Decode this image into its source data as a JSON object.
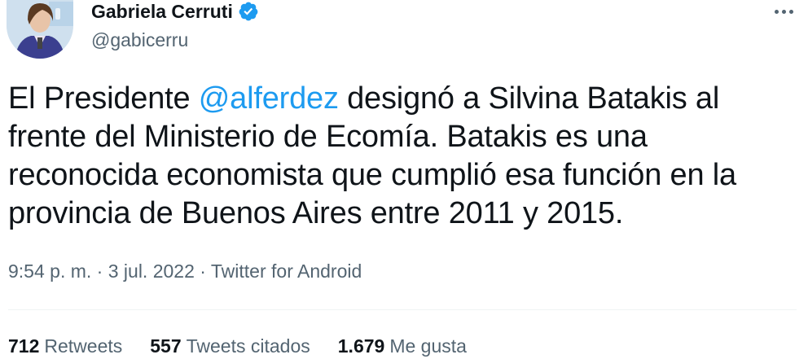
{
  "author": {
    "display_name": "Gabriela Cerruti",
    "handle": "@gabicerru",
    "verified": true,
    "verified_color": "#1d9bf0"
  },
  "tweet": {
    "text_before": "El Presidente ",
    "mention": "@alferdez",
    "text_after": " designó a Silvina Batakis al frente del Ministerio de Ecomía. Batakis es una reconocida economista que cumplió esa función en la provincia de Buenos Aires entre 2011 y 2015.",
    "mention_color": "#1d9bf0"
  },
  "meta": {
    "time": "9:54 p. m.",
    "separator1": " · ",
    "date": "3 jul. 2022",
    "separator2": " · ",
    "source": "Twitter for Android"
  },
  "stats": {
    "retweets_count": "712",
    "retweets_label": "Retweets",
    "quotes_count": "557",
    "quotes_label": "Tweets citados",
    "likes_count": "1.679",
    "likes_label": "Me gusta"
  },
  "icons": {
    "verified": "verified-badge-icon",
    "more": "more-options-icon"
  }
}
